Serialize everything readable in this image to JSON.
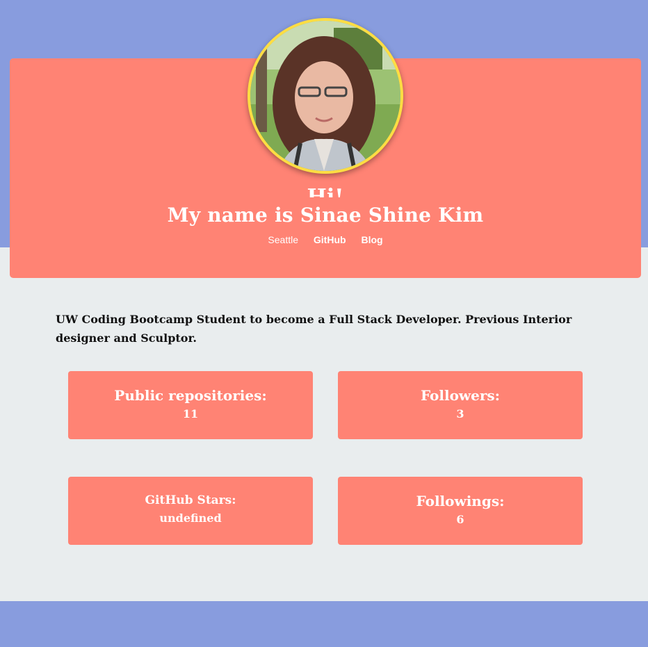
{
  "profile": {
    "greeting": "Hi!",
    "name": "My name is Sinae Shine Kim",
    "location": "Seattle",
    "github_link": "GitHub",
    "blog_link": "Blog",
    "bio": "UW Coding Bootcamp Student to become a Full Stack Developer. Previous Interior designer and Sculptor."
  },
  "stats": {
    "public_repos_label": "Public repositories:",
    "public_repos_value": "11",
    "followers_label": "Followers:",
    "followers_value": "3",
    "stars_label": "GitHub Stars:",
    "stars_value": "undefined",
    "following_label": "Followings:",
    "following_value": "6"
  },
  "colors": {
    "background_blue": "#889cde",
    "card_coral": "#ff8374",
    "page_gray": "#e9edee",
    "avatar_border": "#fedd43"
  }
}
